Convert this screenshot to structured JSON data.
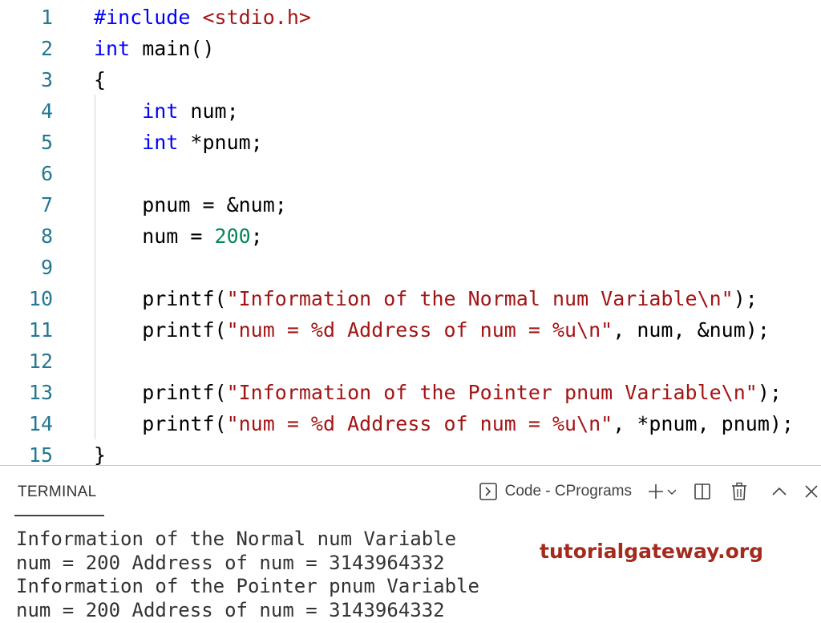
{
  "editor": {
    "lines": [
      {
        "n": "1",
        "tokens": [
          [
            "pp",
            "#include "
          ],
          [
            "inc",
            "<stdio.h>"
          ]
        ]
      },
      {
        "n": "2",
        "tokens": [
          [
            "kw",
            "int"
          ],
          [
            "pl",
            " main()"
          ]
        ]
      },
      {
        "n": "3",
        "tokens": [
          [
            "pl",
            "{"
          ]
        ]
      },
      {
        "n": "4",
        "tokens": [
          [
            "pl",
            "    "
          ],
          [
            "kw",
            "int"
          ],
          [
            "pl",
            " num;"
          ]
        ]
      },
      {
        "n": "5",
        "tokens": [
          [
            "pl",
            "    "
          ],
          [
            "kw",
            "int"
          ],
          [
            "pl",
            " *pnum;"
          ]
        ]
      },
      {
        "n": "6",
        "tokens": []
      },
      {
        "n": "7",
        "tokens": [
          [
            "pl",
            "    pnum = &num;"
          ]
        ]
      },
      {
        "n": "8",
        "tokens": [
          [
            "pl",
            "    num = "
          ],
          [
            "num",
            "200"
          ],
          [
            "pl",
            ";"
          ]
        ]
      },
      {
        "n": "9",
        "tokens": []
      },
      {
        "n": "10",
        "tokens": [
          [
            "pl",
            "    printf("
          ],
          [
            "str",
            "\"Information of the Normal num Variable\\n\""
          ],
          [
            "pl",
            ");"
          ]
        ]
      },
      {
        "n": "11",
        "tokens": [
          [
            "pl",
            "    printf("
          ],
          [
            "str",
            "\"num = %d Address of num = %u\\n\""
          ],
          [
            "pl",
            ", num, &num);"
          ]
        ]
      },
      {
        "n": "12",
        "tokens": []
      },
      {
        "n": "13",
        "tokens": [
          [
            "pl",
            "    printf("
          ],
          [
            "str",
            "\"Information of the Pointer pnum Variable\\n\""
          ],
          [
            "pl",
            ");"
          ]
        ]
      },
      {
        "n": "14",
        "tokens": [
          [
            "pl",
            "    printf("
          ],
          [
            "str",
            "\"num = %d Address of num = %u\\n\""
          ],
          [
            "pl",
            ", *pnum, pnum);"
          ]
        ]
      },
      {
        "n": "15",
        "tokens": [
          [
            "pl",
            "}"
          ]
        ]
      }
    ]
  },
  "panel": {
    "tab_label": "TERMINAL",
    "shell_label": "Code - CPrograms",
    "icons": [
      "terminal-shell-icon",
      "plus-icon",
      "chevron-down-icon",
      "split-icon",
      "trash-icon",
      "chevron-up-icon",
      "close-icon"
    ],
    "output": [
      "Information of the Normal num Variable",
      "num = 200 Address of num = 3143964332",
      "Information of the Pointer pnum Variable",
      "num = 200 Address of num = 3143964332"
    ]
  },
  "watermark": {
    "text": "tutorialgateway.org"
  },
  "colors": {
    "keyword": "#0000ff",
    "string": "#a31515",
    "number": "#098658",
    "line_number": "#237893",
    "watermark": "#a32a1d"
  }
}
